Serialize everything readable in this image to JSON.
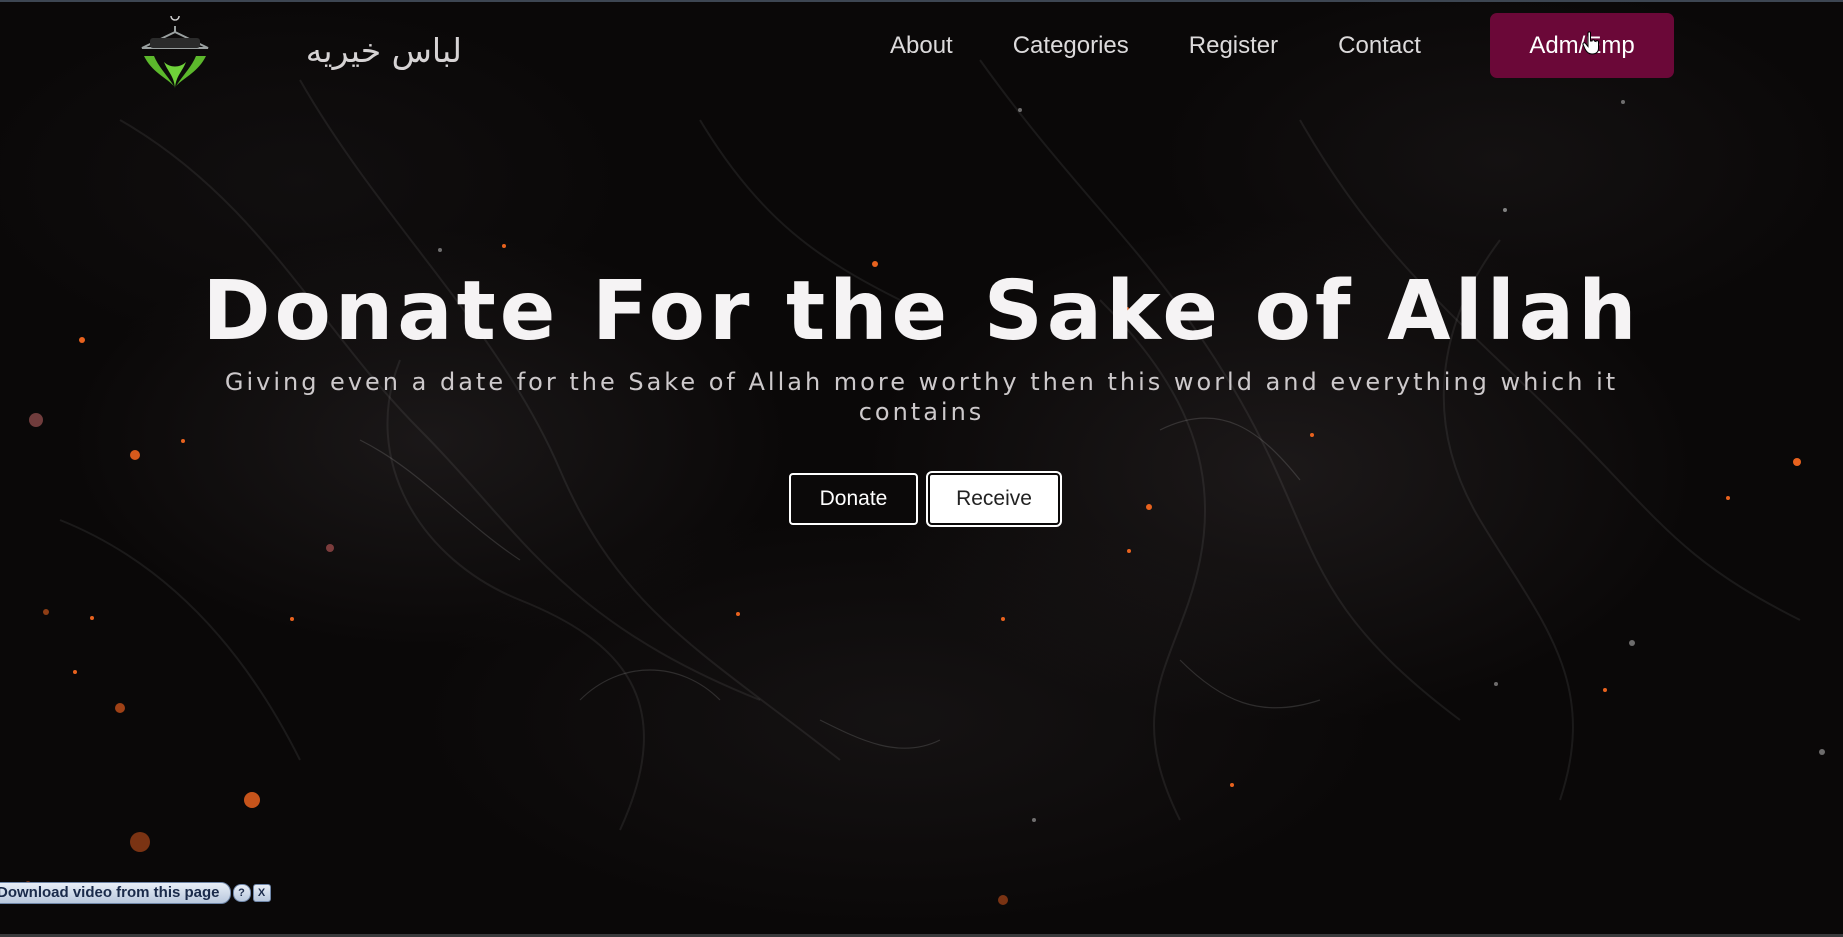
{
  "header": {
    "brand_title": "لباس خیریه",
    "logo_icon": "charity-hands-hanger-logo",
    "nav_items": [
      {
        "label": "About"
      },
      {
        "label": "Categories"
      },
      {
        "label": "Register"
      },
      {
        "label": "Contact"
      }
    ],
    "cta_label": "Adm/Emp"
  },
  "hero": {
    "title": "Donate For the Sake of Allah",
    "subtitle": "Giving even a date for the Sake of Allah more worthy then this world and everything which it contains",
    "donate_label": "Donate",
    "receive_label": "Receive"
  },
  "video_download_bar": {
    "label": "Download video from this page",
    "help_label": "?",
    "close_label": "X"
  },
  "colors": {
    "background": "#0a0808",
    "cta_background": "#6b0838",
    "logo_green": "#5cb82c",
    "ember": "#e8621e"
  }
}
